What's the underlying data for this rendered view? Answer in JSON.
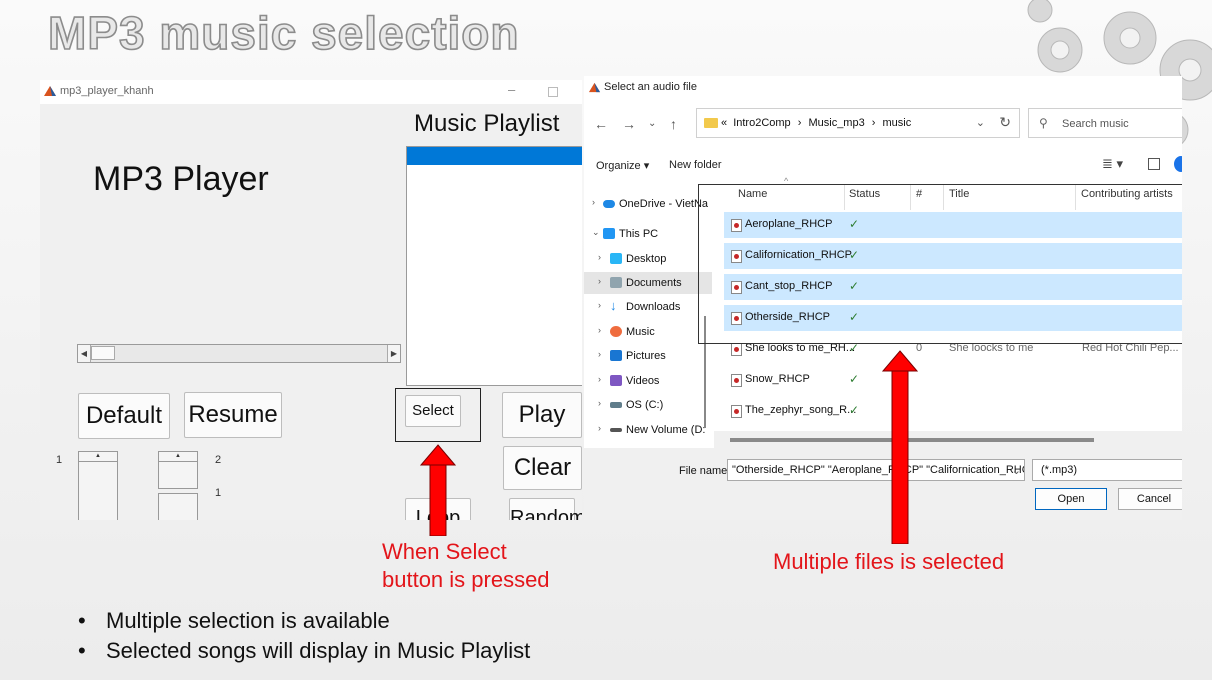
{
  "slide": {
    "title": "MP3 music selection",
    "annotation_select": [
      "When Select",
      "button is pressed"
    ],
    "annotation_multi": "Multiple files is selected",
    "bullets": [
      "Multiple selection is available",
      "Selected songs will display in Music Playlist"
    ]
  },
  "mp3_window": {
    "title": "mp3_player_khanh",
    "heading": "MP3 Player",
    "playlist_label": "Music Playlist",
    "buttons": {
      "default": "Default",
      "resume": "Resume",
      "select": "Select",
      "play": "Play",
      "clear": "Clear",
      "loop": "Loop",
      "random": "Random"
    },
    "spinner_labels": [
      "1",
      "2",
      "1"
    ]
  },
  "file_dialog": {
    "title": "Select an audio file",
    "breadcrumb": [
      "«",
      "Intro2Comp",
      "Music_mp3",
      "music"
    ],
    "search_placeholder": "Search music",
    "toolbar": {
      "organize": "Organize ▾",
      "new_folder": "New folder"
    },
    "nav": [
      {
        "label": "OneDrive - VietNa",
        "icon": "cloud-icon"
      },
      {
        "label": "This PC",
        "icon": "computer-icon"
      },
      {
        "label": "Desktop",
        "icon": "desktop-icon"
      },
      {
        "label": "Documents",
        "icon": "documents-icon"
      },
      {
        "label": "Downloads",
        "icon": "downloads-icon"
      },
      {
        "label": "Music",
        "icon": "music-icon"
      },
      {
        "label": "Pictures",
        "icon": "pictures-icon"
      },
      {
        "label": "Videos",
        "icon": "videos-icon"
      },
      {
        "label": "OS (C:)",
        "icon": "drive-icon"
      },
      {
        "label": "New Volume (D:",
        "icon": "drive-icon"
      }
    ],
    "columns": [
      "Name",
      "Status",
      "#",
      "Title",
      "Contributing artists"
    ],
    "files": [
      {
        "name": "Aeroplane_RHCP",
        "status": "✓",
        "num": "",
        "title": "",
        "artist": "",
        "selected": true
      },
      {
        "name": "Californication_RHCP",
        "status": "✓",
        "num": "",
        "title": "",
        "artist": "",
        "selected": true
      },
      {
        "name": "Cant_stop_RHCP",
        "status": "✓",
        "num": "",
        "title": "",
        "artist": "",
        "selected": true
      },
      {
        "name": "Otherside_RHCP",
        "status": "✓",
        "num": "",
        "title": "",
        "artist": "",
        "selected": true
      },
      {
        "name": "She looks to me_RH...",
        "status": "✓",
        "num": "0",
        "title": "She loocks to me",
        "artist": "Red Hot Chili Pep...",
        "selected": false
      },
      {
        "name": "Snow_RHCP",
        "status": "✓",
        "num": "",
        "title": "",
        "artist": "",
        "selected": false
      },
      {
        "name": "The_zephyr_song_R...",
        "status": "✓",
        "num": "",
        "title": "",
        "artist": "",
        "selected": false
      }
    ],
    "file_name_label": "File name:",
    "file_name_value": "\"Otherside_RHCP\" \"Aeroplane_RHCP\" \"Californication_RHCP\" \"C",
    "file_type": "(*.mp3)",
    "open_button": "Open",
    "cancel_button": "Cancel"
  },
  "colors": {
    "annotation": "#e3151a",
    "selection": "#cce8ff",
    "listbox_highlight": "#0078d7"
  }
}
